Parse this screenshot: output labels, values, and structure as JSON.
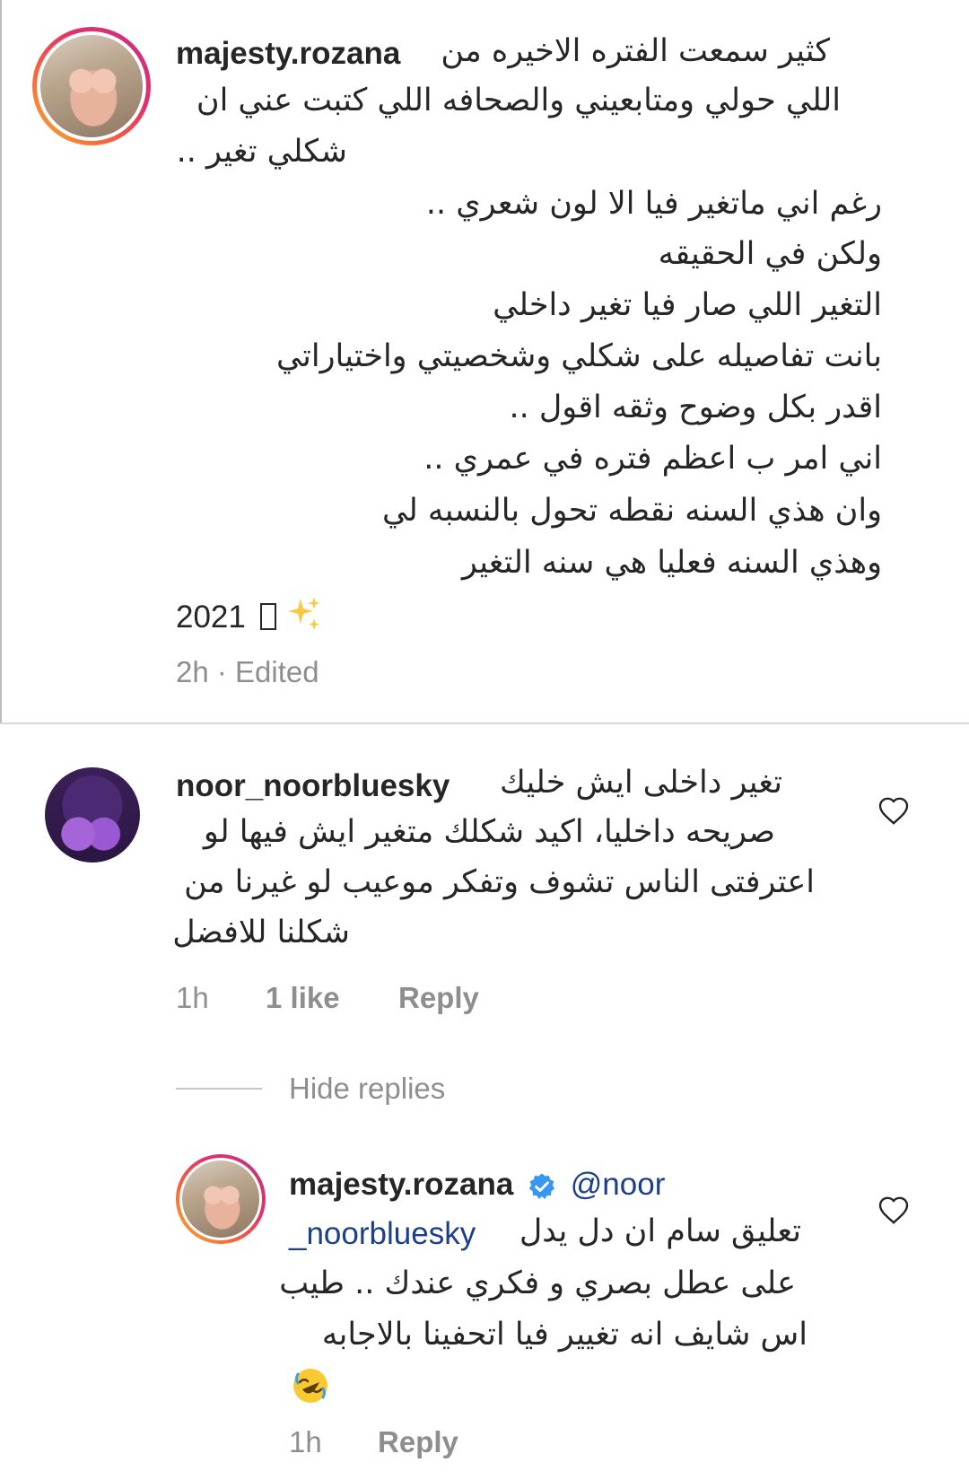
{
  "comment1": {
    "username": "majesty.rozana",
    "lines": [
      "كثير سمعت الفتره الاخيره من",
      "اللي حولي ومتابعيني والصحافه اللي كتبت عني ان",
      "شكلي تغير ..",
      "رغم اني ماتغير فيا الا لون شعري ..",
      "ولكن في الحقيقه",
      "التغير اللي صار فيا تغير داخلي",
      "بانت تفاصيله على شكلي وشخصيتي واختياراتي",
      "اقدر بكل وضوح وثقه اقول ..",
      "اني امر ب اعظم فتره في عمري ..",
      "وان هذي السنه نقطه تحول بالنسبه لي",
      "وهذي السنه فعليا هي سنه التغير"
    ],
    "year_line": "2021",
    "meta": "2h · Edited"
  },
  "comment2": {
    "username": "noor_noorbluesky",
    "first_line_text": "تغير داخلى ايش خليك",
    "lines": [
      "صريحه داخليا، اكيد شكلك متغير ايش فيها لو",
      "اعترفتى الناس تشوف وتفكر موعيب لو غيرنا من",
      "شكلنا للافضل"
    ],
    "time": "1h",
    "likes": "1 like",
    "reply": "Reply",
    "hide_replies": "Hide replies"
  },
  "reply1": {
    "username": "majesty.rozana",
    "mention_part1": "@noor",
    "mention_part2": "_noorbluesky",
    "first_line_text": "تعليق سام ان دل يدل",
    "lines": [
      "على عطل بصري و فكري عندك .. طيب",
      "اس شايف انه تغيير فيا اتحفينا بالاجابه"
    ],
    "time": "1h",
    "reply": "Reply"
  },
  "colors": {
    "text": "#262626",
    "meta": "#8e8e8e",
    "verified": "#3897f0",
    "mention": "#1c3f8a"
  }
}
